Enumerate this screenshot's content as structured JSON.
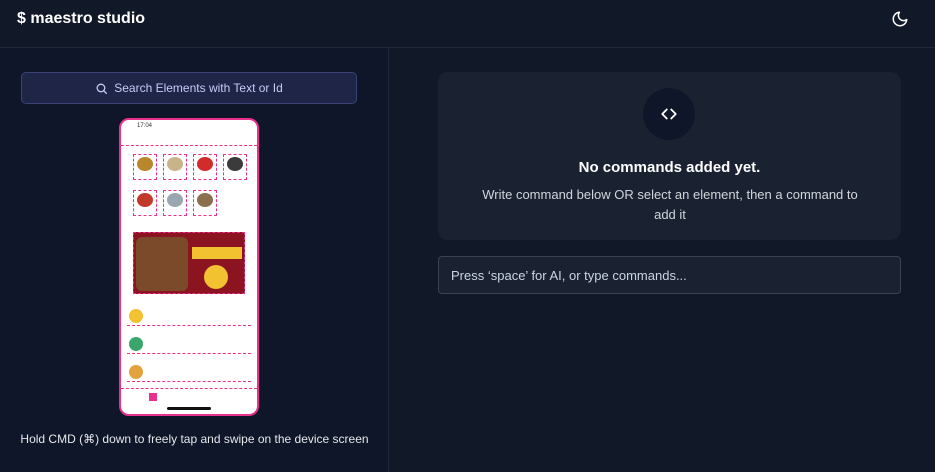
{
  "header": {
    "logo": "$ maestro studio",
    "theme_toggle_icon": "moon-icon"
  },
  "left": {
    "search_label": "Search Elements with Text or Id",
    "hint": "Hold CMD (⌘) down to freely tap and swipe on the device screen"
  },
  "device": {
    "status_time": "17:04"
  },
  "right": {
    "empty_title": "No commands added yet.",
    "empty_subtitle": "Write command below OR select an element, then a command to add it",
    "command_placeholder": "Press ‘space’ for AI, or type commands..."
  },
  "colors": {
    "accent": "#e8308c",
    "background": "#111827",
    "card": "#1a2232"
  }
}
